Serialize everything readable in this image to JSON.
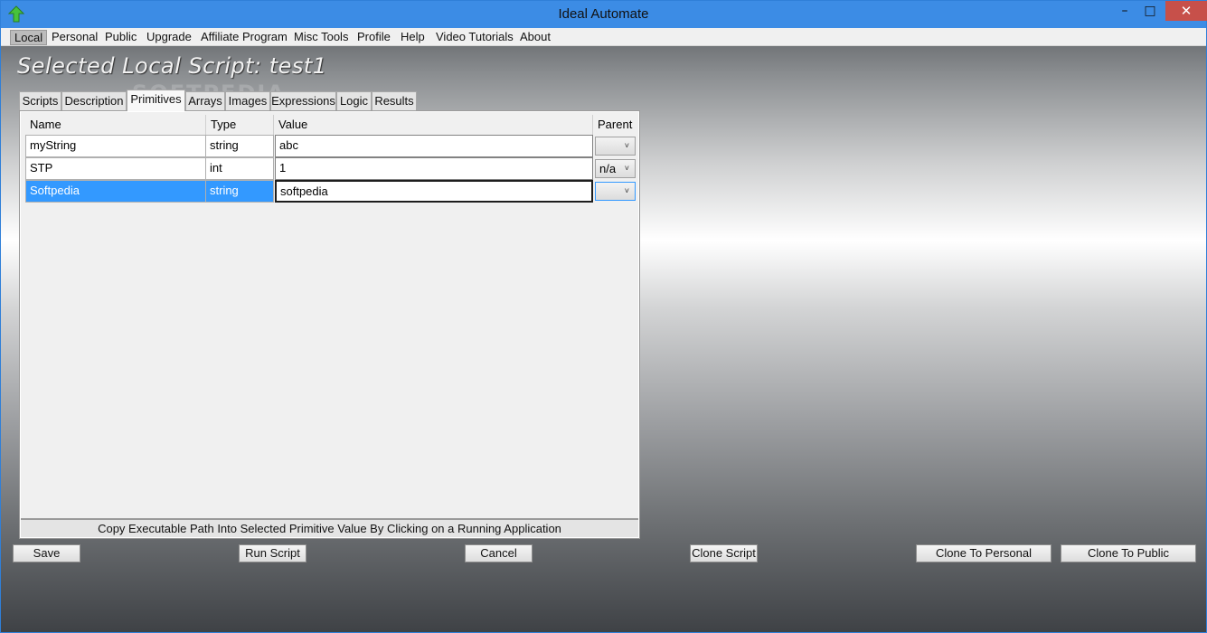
{
  "window": {
    "title": "Ideal Automate",
    "minimize_glyph": "–",
    "maximize_glyph": "□",
    "close_glyph": "✕"
  },
  "menu": [
    {
      "label": "Local",
      "active": true
    },
    {
      "label": "Personal"
    },
    {
      "label": "Public"
    },
    {
      "label": "Upgrade"
    },
    {
      "label": "Affiliate Program"
    },
    {
      "label": "Misc Tools"
    },
    {
      "label": "Profile"
    },
    {
      "label": "Help"
    },
    {
      "label": "Video Tutorials"
    },
    {
      "label": "About"
    }
  ],
  "heading": "Selected Local Script:  test1",
  "watermark": "SOFTPEDIA",
  "tabs": [
    {
      "label": "Scripts"
    },
    {
      "label": "Description"
    },
    {
      "label": "Primitives",
      "selected": true
    },
    {
      "label": "Arrays"
    },
    {
      "label": "Images"
    },
    {
      "label": "Expressions"
    },
    {
      "label": "Logic"
    },
    {
      "label": "Results"
    }
  ],
  "grid": {
    "columns": [
      "Name",
      "Type",
      "Value",
      "Parent"
    ],
    "rows": [
      {
        "name": "myString",
        "type": "string",
        "value": "abc",
        "parent": ""
      },
      {
        "name": "STP",
        "type": "int",
        "value": "1",
        "parent": "n/a"
      },
      {
        "name": "Softpedia",
        "type": "string",
        "value": "softpedia",
        "parent": "",
        "selected": true
      }
    ],
    "combo_arrow": "˅"
  },
  "status_text": "Copy Executable Path Into Selected Primitive Value By Clicking on a Running Application",
  "buttons": {
    "save": "Save",
    "run_script": "Run Script",
    "cancel": "Cancel",
    "clone_script": "Clone Script",
    "clone_to_personal": "Clone To Personal",
    "clone_to_public": "Clone To Public"
  },
  "colors": {
    "titlebar": "#3c8ce5",
    "selection": "#3399ff",
    "close_button": "#c7504a"
  }
}
